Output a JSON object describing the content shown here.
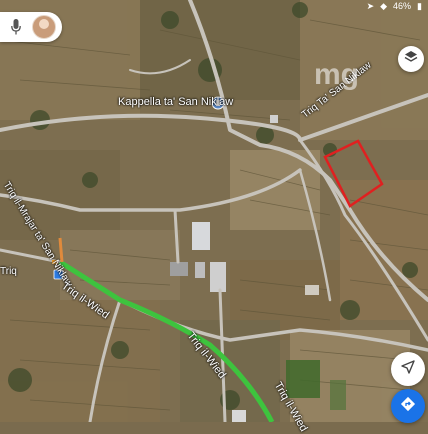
{
  "status_bar": {
    "battery": "46%"
  },
  "search": {
    "mic_icon": "mic-icon",
    "avatar": "user-avatar"
  },
  "map": {
    "poi": {
      "name": "Kappella ta' San Niklaw",
      "icon": "landmark-pin"
    },
    "roads": [
      {
        "id": "triq-ta-san-niklaw",
        "name": "Triq Ta' San Niklaw"
      },
      {
        "id": "triq-mrajar",
        "name": "Triq il-Mrajar ta' San Niklaw"
      },
      {
        "id": "triq-il-wied-1",
        "name": "Triq il-Wied"
      },
      {
        "id": "triq-il-wied-2",
        "name": "Triq il-Wied"
      },
      {
        "id": "triq-il-wied-3",
        "name": "Triq il-Wied"
      },
      {
        "id": "triq-left",
        "name": "Triq"
      }
    ],
    "watermark": "mg",
    "plot_outline_color": "#e02020",
    "route_color": "#3ec33e"
  },
  "controls": {
    "layers_icon": "layers-icon",
    "compass_icon": "my-location-icon",
    "directions_icon": "directions-icon"
  }
}
